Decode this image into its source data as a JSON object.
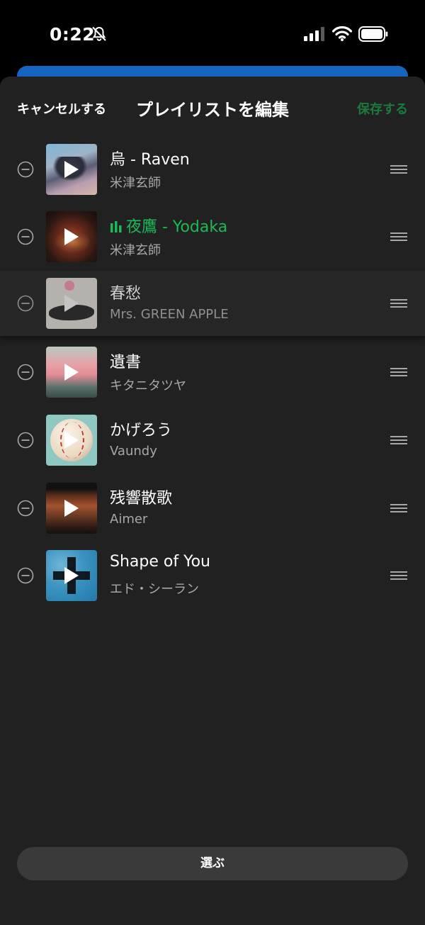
{
  "status_bar": {
    "time": "0:22",
    "icons": [
      "bell-slash-icon",
      "cellular-signal-icon",
      "wifi-icon",
      "battery-icon"
    ]
  },
  "header": {
    "cancel_label": "キャンセルする",
    "title": "プレイリストを編集",
    "save_label": "保存する"
  },
  "colors": {
    "accent_green": "#1db954",
    "save_disabled": "#1a7a3c",
    "sheet_bg": "#212121",
    "blue": "#1565c0"
  },
  "tracks": [
    {
      "title": "烏 - Raven",
      "artist": "米津玄師"
    },
    {
      "title": "夜鷹 - Yodaka",
      "artist": "米津玄師"
    },
    {
      "title": "春愁",
      "artist": "Mrs. GREEN APPLE"
    },
    {
      "title": "遺書",
      "artist": "キタニタツヤ"
    },
    {
      "title": "かげろう",
      "artist": "Vaundy"
    },
    {
      "title": "残響散歌",
      "artist": "Aimer"
    },
    {
      "title": "Shape of You",
      "artist": "エド・シーラン"
    }
  ],
  "select_button": {
    "label": "選ぶ"
  }
}
